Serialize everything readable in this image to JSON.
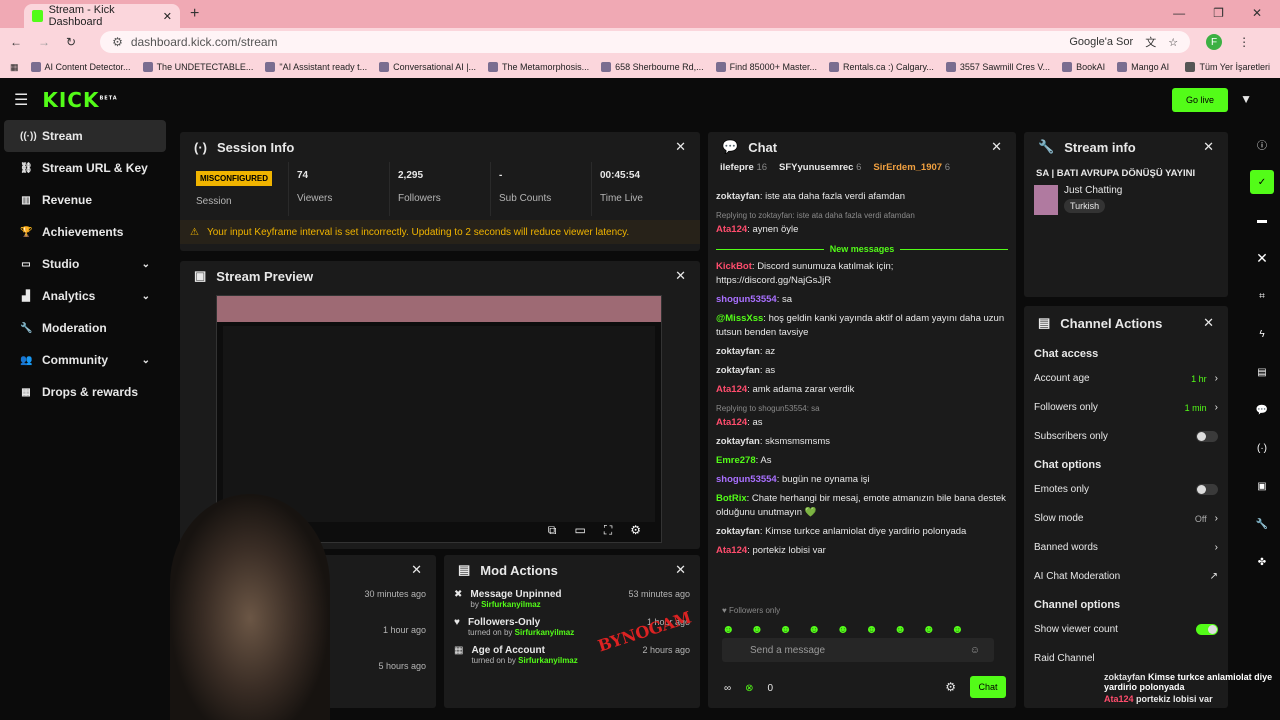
{
  "browser": {
    "tab_title": "Stream - Kick Dashboard",
    "url": "dashboard.kick.com/stream",
    "google_btn": "Google'a Sor",
    "profile": "F",
    "bookmarks": [
      "AI Content Detector...",
      "The UNDETECTABLE...",
      "\"AI Assistant ready t...",
      "Conversational AI |...",
      "The Metamorphosis...",
      "658 Sherbourne Rd,...",
      "Find 85000+ Master...",
      "Rentals.ca :) Calgary...",
      "3557 Sawmill Cres V...",
      "BookAI",
      "Mango AI"
    ],
    "all_bookmarks": "Tüm Yer İşaretleri"
  },
  "topnav": {
    "logo": "KICK",
    "logo_tag": "BETA",
    "go_live": "Go live"
  },
  "sidebar": {
    "items": [
      {
        "label": "Stream",
        "icon": "broadcast-icon"
      },
      {
        "label": "Stream URL & Key",
        "icon": "link-icon"
      },
      {
        "label": "Revenue",
        "icon": "revenue-icon"
      },
      {
        "label": "Achievements",
        "icon": "trophy-icon"
      },
      {
        "label": "Studio",
        "icon": "studio-icon"
      },
      {
        "label": "Analytics",
        "icon": "analytics-icon"
      },
      {
        "label": "Moderation",
        "icon": "wrench-icon"
      },
      {
        "label": "Community",
        "icon": "community-icon"
      },
      {
        "label": "Drops & rewards",
        "icon": "drops-icon"
      }
    ]
  },
  "session": {
    "title": "Session Info",
    "status": "MISCONFIGURED",
    "status_label": "Session",
    "viewers": "74",
    "viewers_label": "Viewers",
    "followers": "2,295",
    "followers_label": "Followers",
    "subs": "-",
    "subs_label": "Sub Counts",
    "time": "00:45:54",
    "time_label": "Time Live",
    "warning": "Your input Keyframe interval is set incorrectly. Updating to 2 seconds will reduce viewer latency."
  },
  "preview": {
    "title": "Stream Preview"
  },
  "activity": {
    "times": [
      "30 minutes ago",
      "1 hour ago",
      "5 hours ago"
    ],
    "frag1": "at",
    "frag2": "annel"
  },
  "mod_actions": {
    "title": "Mod Actions",
    "items": [
      {
        "action": "Message Unpinned",
        "pre": "by",
        "user": "Sirfurkanyilmaz",
        "time": "53 minutes ago"
      },
      {
        "action": "Followers-Only",
        "pre": "turned on by",
        "user": "Sirfurkanyilmaz",
        "time": "1 hour ago"
      },
      {
        "action": "Age of Account",
        "pre": "turned on by",
        "user": "Sirfurkanyilmaz",
        "time": "2 hours ago"
      }
    ]
  },
  "chat": {
    "title": "Chat",
    "top_users": [
      {
        "name": "ilefepre",
        "count": "16"
      },
      {
        "name": "SFYyunusemrec",
        "count": "6"
      },
      {
        "name": "SirErdem_1907",
        "count": "6"
      }
    ],
    "messages": [
      {
        "name": "zoktayfan",
        "color": "#e0e0e0",
        "text": "iste ata daha fazla verdi afamdan"
      },
      {
        "reply": "Replying to zoktayfan: iste ata daha fazla verdi afamdan",
        "name": "Ata124",
        "color": "#ff4d6d",
        "text": "aynen öyle"
      }
    ],
    "new_messages": "New messages",
    "messages2": [
      {
        "name": "KickBot",
        "color": "#ff4d6d",
        "text": "Discord sunumuza katılmak için; https://discord.gg/NajGsJjR"
      },
      {
        "name": "shogun53554",
        "color": "#a970ff",
        "text": "sa"
      },
      {
        "name": "@MissXss",
        "color": "#53fc18",
        "text": "hoş geldin kanki yayında aktif ol adam yayını daha uzun tutsun benden tavsiye"
      },
      {
        "name": "zoktayfan",
        "color": "#e0e0e0",
        "text": "az"
      },
      {
        "name": "zoktayfan",
        "color": "#e0e0e0",
        "text": "as"
      },
      {
        "name": "Ata124",
        "color": "#ff4d6d",
        "text": "amk adama zarar verdik"
      },
      {
        "reply": "Replying to shogun53554: sa",
        "name": "Ata124",
        "color": "#ff4d6d",
        "text": "as"
      },
      {
        "name": "zoktayfan",
        "color": "#e0e0e0",
        "text": "sksmsmsmsms"
      },
      {
        "name": "Emre278",
        "color": "#53fc18",
        "text": "As"
      },
      {
        "name": "shogun53554",
        "color": "#a970ff",
        "text": "bugün ne oynama işi"
      },
      {
        "name": "BotRix",
        "color": "#53fc18",
        "text": "Chate herhangi bir mesaj, emote atmanızın bile bana destek olduğunu unutmayın 💚"
      },
      {
        "name": "zoktayfan",
        "color": "#e0e0e0",
        "text": "Kimse turkce anlamiolat diye yardirio polonyada"
      },
      {
        "name": "Ata124",
        "color": "#ff4d6d",
        "text": "portekiz lobisi var"
      }
    ],
    "followers_only": "Followers only",
    "placeholder": "Send a message",
    "count": "0",
    "send": "Chat"
  },
  "stream_info": {
    "title": "Stream info",
    "stream_title": "SA | BATI AVRUPA DÖNÜŞÜ YAYINI",
    "category": "Just Chatting",
    "language": "Turkish"
  },
  "channel_actions": {
    "title": "Channel Actions",
    "chat_access": "Chat access",
    "account_age": "Account age",
    "account_age_val": "1 hr",
    "followers_only": "Followers only",
    "followers_only_val": "1 min",
    "subscribers_only": "Subscribers only",
    "chat_options": "Chat options",
    "emotes_only": "Emotes only",
    "slow_mode": "Slow mode",
    "slow_mode_val": "Off",
    "banned_words": "Banned words",
    "ai_mod": "AI Chat Moderation",
    "channel_options": "Channel options",
    "show_viewer_count": "Show viewer count",
    "raid_channel": "Raid Channel"
  },
  "overlay": {
    "name1": "zoktayfan",
    "msg1": "Kimse turkce anlamiolat diye yardirio polonyada",
    "name2": "Ata124",
    "msg2": "portekiz lobisi var",
    "brand": "BYNOGAM"
  },
  "colors": {
    "accent": "#53fc18",
    "warning": "#f0b400"
  }
}
